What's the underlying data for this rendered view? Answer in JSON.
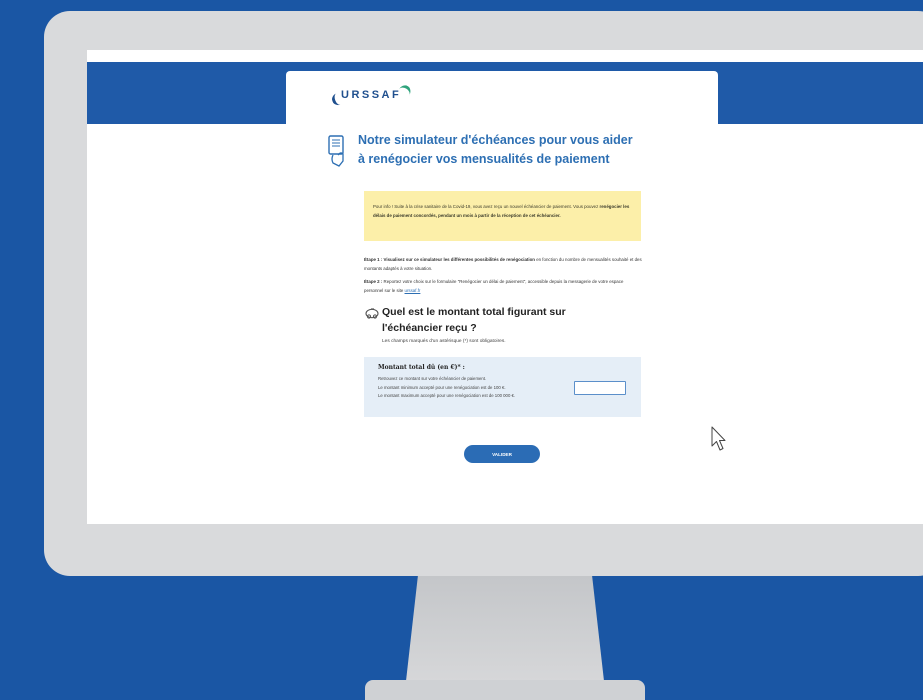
{
  "brand": {
    "logo_text": "URSSAF"
  },
  "page": {
    "title_line1": "Notre simulateur d'échéances pour vous aider",
    "title_line2": "à renégocier vos mensualités de paiement"
  },
  "info_box": {
    "part1": "Pour info ! Suite à la crise sanitaire de la Covid-19, vous avez reçu un nouvel échéancier de paiement. Vous pouvez ",
    "bold": "renégocier les délais de paiement concordés, pendant un mois à partir de la réception de cet échéancier."
  },
  "steps": [
    {
      "prefix": "Étape 1 :",
      "bold": " Visualisez sur ce simulateur les différentes possibilités de renégociation",
      "rest": " en fonction du nombre de mensualités souhaité et des montants adaptés à votre situation."
    },
    {
      "prefix": "Étape 2 :",
      "rest": " Reportez votre choix sur le formulaire \"Renégocier un délai de paiement\", accessible depuis la messagerie de votre espace personnel sur le site ",
      "link": "urssaf.fr"
    }
  ],
  "question": {
    "text": "Quel est le montant total figurant sur l'échéancier reçu ?",
    "required_note": "Les champs marqués d'un astérisque (*) sont obligatoires."
  },
  "amount_field": {
    "label": "Montant total dû (en €)* :",
    "help_line1": "Retrouvez ce montant sur votre échéancier de paiement.",
    "help_line2": "Le montant minimum accepté pour une renégociation est de 100 €.",
    "help_line3": "Le montant maximum accepté pour une renégociation est de 100 000 €.",
    "value": ""
  },
  "submit": {
    "label": "VALIDER"
  },
  "colors": {
    "background": "#1a56a4",
    "accent": "#2d6fb3",
    "info_bg": "#fcefa9",
    "field_bg": "#e5eef7",
    "button": "#2b6cb5"
  },
  "icons": [
    "document-hand-icon",
    "piggy-bank-icon",
    "mouse-cursor-icon"
  ]
}
